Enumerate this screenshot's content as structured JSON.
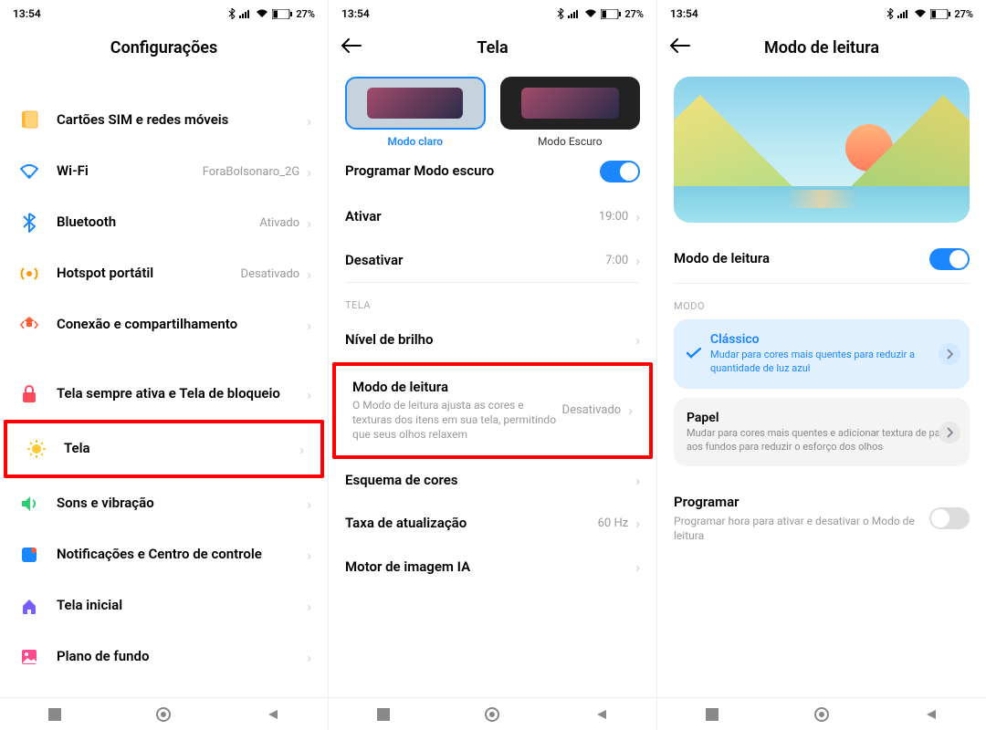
{
  "status": {
    "time": "13:54",
    "battery": "27%"
  },
  "nav": {
    "recents": "recents",
    "home": "home",
    "back": "back"
  },
  "screen1": {
    "title": "Configurações",
    "items": [
      {
        "label": "Cartões SIM e redes móveis",
        "icon": "sim-icon"
      },
      {
        "label": "Wi-Fi",
        "value": "ForaBolsonaro_2G",
        "icon": "wifi-icon"
      },
      {
        "label": "Bluetooth",
        "value": "Ativado",
        "icon": "bluetooth-icon"
      },
      {
        "label": "Hotspot portátil",
        "value": "Desativado",
        "icon": "hotspot-icon"
      },
      {
        "label": "Conexão e compartilhamento",
        "icon": "share-icon"
      },
      {
        "label": "Tela sempre ativa e Tela de bloqueio",
        "icon": "lock-icon"
      },
      {
        "label": "Tela",
        "icon": "sun-icon"
      },
      {
        "label": "Sons e vibração",
        "icon": "sound-icon"
      },
      {
        "label": "Notificações e Centro de controle",
        "icon": "notif-icon"
      },
      {
        "label": "Tela inicial",
        "icon": "home-icon"
      },
      {
        "label": "Plano de fundo",
        "icon": "wallpaper-icon"
      }
    ]
  },
  "screen2": {
    "title": "Tela",
    "modeLight": "Modo claro",
    "modeDark": "Modo Escuro",
    "schedule": "Programar Modo escuro",
    "activate": {
      "label": "Ativar",
      "value": "19:00"
    },
    "deactivate": {
      "label": "Desativar",
      "value": "7:00"
    },
    "section": "TELA",
    "brightness": "Nível de brilho",
    "reading": {
      "label": "Modo de leitura",
      "desc": "O Modo de leitura ajusta as cores e texturas dos itens em sua tela, permitindo que seus olhos relaxem",
      "value": "Desativado"
    },
    "colorscheme": "Esquema de cores",
    "refresh": {
      "label": "Taxa de atualização",
      "value": "60 Hz"
    },
    "aiengine": "Motor de imagem IA"
  },
  "screen3": {
    "title": "Modo de leitura",
    "toggleLabel": "Modo de leitura",
    "section": "MODO",
    "classic": {
      "title": "Clássico",
      "desc": "Mudar para cores mais quentes para reduzir a quantidade de luz azul"
    },
    "paper": {
      "title": "Papel",
      "desc": "Mudar para cores mais quentes e adicionar textura de papel aos fundos para reduzir o esforço dos olhos"
    },
    "schedule": {
      "title": "Programar",
      "desc": "Programar hora para ativar e desativar o Modo de leitura"
    }
  }
}
